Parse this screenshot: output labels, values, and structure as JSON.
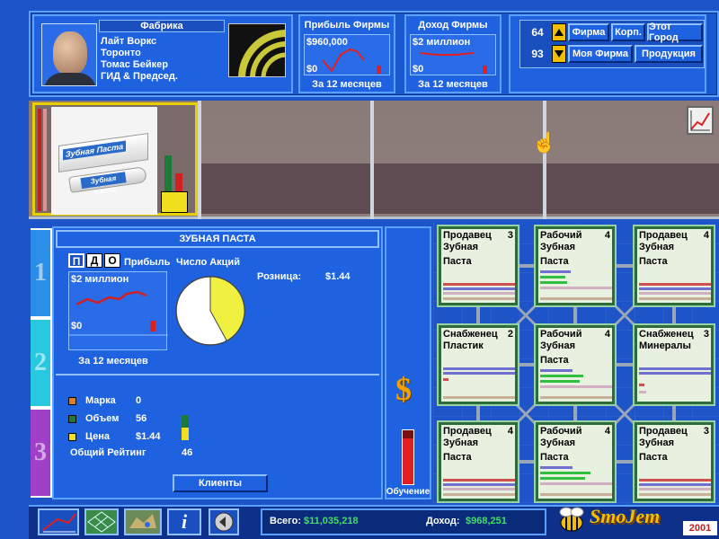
{
  "header": {
    "company_title": "Фабрика",
    "company_lines": [
      "Лайт Воркс",
      "Торонто",
      "Томас Бейкер",
      "ГИД & Председ."
    ],
    "profit_title": "Прибыль Фирмы",
    "profit_value": "$960,000",
    "profit_zero": "$0",
    "profit_period": "За 12 месяцев",
    "income_title": "Доход Фирмы",
    "income_value": "$2 миллион",
    "income_zero": "$0",
    "income_period": "За 12 месяцев",
    "num_top": "64",
    "num_bottom": "93",
    "btn_firm": "Фирма",
    "btn_corp": "Корп.",
    "btn_city": "Этот Город",
    "btn_my_firm": "Моя Фирма",
    "btn_products": "Продукция"
  },
  "product": {
    "box_label": "Зубная Паста",
    "tube_label": "Зубная паста"
  },
  "details": {
    "title": "ЗУБНАЯ ПАСТА",
    "pdo": [
      "П",
      "Д",
      "О"
    ],
    "profit_label": "Прибыль",
    "shares_label": "Число Акций",
    "chart_value": "$2 миллион",
    "chart_zero": "$0",
    "chart_period": "За 12 месяцев",
    "retail_label": "Розница:",
    "retail_value": "$1.44",
    "ratings": [
      {
        "label": "Марка",
        "value": "0",
        "color": "#e07a2a"
      },
      {
        "label": "Объем",
        "value": "56",
        "color": "#1b7a3a"
      },
      {
        "label": "Цена",
        "value": "$1.44",
        "color": "#f0e020"
      }
    ],
    "overall_label": "Общий Рейтинг",
    "overall_value": "46",
    "clients_btn": "Клиенты",
    "pie_share": 0.42
  },
  "side_tabs": [
    "1",
    "2",
    "3"
  ],
  "training": {
    "dollar": "$",
    "label": "Обучение",
    "level": 0.85
  },
  "nodes": [
    {
      "role": "Продавец",
      "num": "3",
      "line1": "Зубная",
      "line2": "Паста"
    },
    {
      "role": "Рабочий",
      "num": "4",
      "line1": "Зубная",
      "line2": "Паста"
    },
    {
      "role": "Продавец",
      "num": "4",
      "line1": "Зубная",
      "line2": "Паста"
    },
    {
      "role": "Снабженец",
      "num": "2",
      "line1": "Пластик",
      "line2": ""
    },
    {
      "role": "Рабочий",
      "num": "4",
      "line1": "Зубная",
      "line2": "Паста"
    },
    {
      "role": "Снабженец",
      "num": "3",
      "line1": "Минералы",
      "line2": ""
    },
    {
      "role": "Продавец",
      "num": "4",
      "line1": "Зубная",
      "line2": "Паста"
    },
    {
      "role": "Рабочий",
      "num": "4",
      "line1": "Зубная",
      "line2": "Паста"
    },
    {
      "role": "Продавец",
      "num": "3",
      "line1": "Зубная",
      "line2": "Паста"
    }
  ],
  "footer": {
    "total_label": "Всего:",
    "total_value": "$11,035,218",
    "income_label": "Доход:",
    "income_value": "$968,251",
    "logo": "SmoJem",
    "year": "2001"
  }
}
